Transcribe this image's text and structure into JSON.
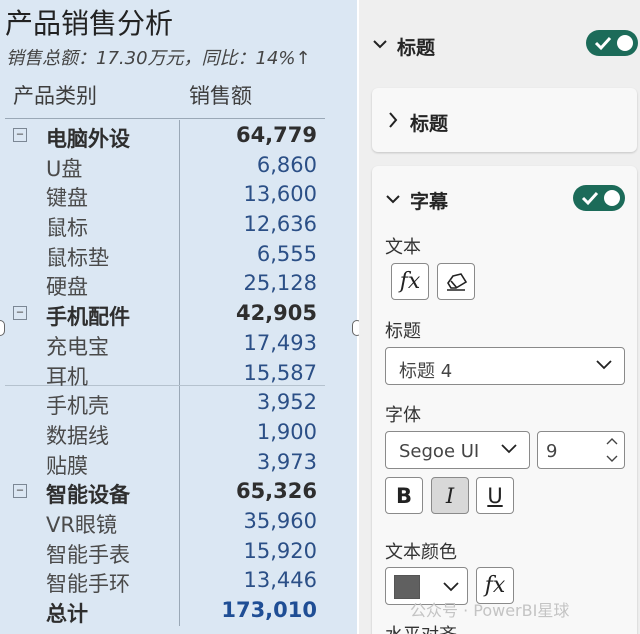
{
  "visual": {
    "title": "产品销售分析",
    "subtitle": "销售总额：17.30万元，同比：14%↑",
    "columns": {
      "category": "产品类别",
      "sales": "销售额"
    },
    "rows": [
      {
        "type": "cat",
        "label": "电脑外设",
        "value": "64,779",
        "toggle": "−"
      },
      {
        "type": "item",
        "label": "U盘",
        "value": "6,860"
      },
      {
        "type": "item",
        "label": "键盘",
        "value": "13,600"
      },
      {
        "type": "item",
        "label": "鼠标",
        "value": "12,636"
      },
      {
        "type": "item",
        "label": "鼠标垫",
        "value": "6,555"
      },
      {
        "type": "item",
        "label": "硬盘",
        "value": "25,128"
      },
      {
        "type": "cat",
        "label": "手机配件",
        "value": "42,905",
        "toggle": "−"
      },
      {
        "type": "item",
        "label": "充电宝",
        "value": "17,493"
      },
      {
        "type": "item",
        "label": "耳机",
        "value": "15,587"
      },
      {
        "type": "item",
        "label": "手机壳",
        "value": "3,952"
      },
      {
        "type": "item",
        "label": "数据线",
        "value": "1,900"
      },
      {
        "type": "item",
        "label": "贴膜",
        "value": "3,973"
      },
      {
        "type": "cat",
        "label": "智能设备",
        "value": "65,326",
        "toggle": "−"
      },
      {
        "type": "item",
        "label": "VR眼镜",
        "value": "35,960"
      },
      {
        "type": "item",
        "label": "智能手表",
        "value": "15,920"
      },
      {
        "type": "item",
        "label": "智能手环",
        "value": "13,446"
      },
      {
        "type": "total",
        "label": "总计",
        "value": "173,010"
      }
    ]
  },
  "format_pane": {
    "title_section": {
      "label": "标题",
      "expanded": true,
      "toggle_on": true
    },
    "title_card": {
      "label": "标题",
      "expanded": false
    },
    "subtitle_section": {
      "label": "字幕",
      "expanded": true,
      "toggle_on": true,
      "text_label": "文本",
      "fx_label": "fx",
      "heading_label": "标题",
      "heading_value": "标题 4",
      "font_label": "字体",
      "font_family_value": "Segoe UI",
      "font_size_value": "9",
      "bold_label": "B",
      "italic_label": "I",
      "underline_label": "U",
      "italic_active": true,
      "text_color_label": "文本颜色",
      "text_color_value": "#606060",
      "color_fx_label": "fx",
      "alignment_label": "水平对齐"
    }
  },
  "watermark": "公众号 · PowerBI星球",
  "colors": {
    "visual_bg": "#dbe7f3",
    "pane_bg": "#efefef",
    "toggle_on": "#1c6b59",
    "value_blue": "#2b4f86",
    "total_blue": "#1f4e95",
    "italic_active_bg": "#d8d8d8"
  }
}
